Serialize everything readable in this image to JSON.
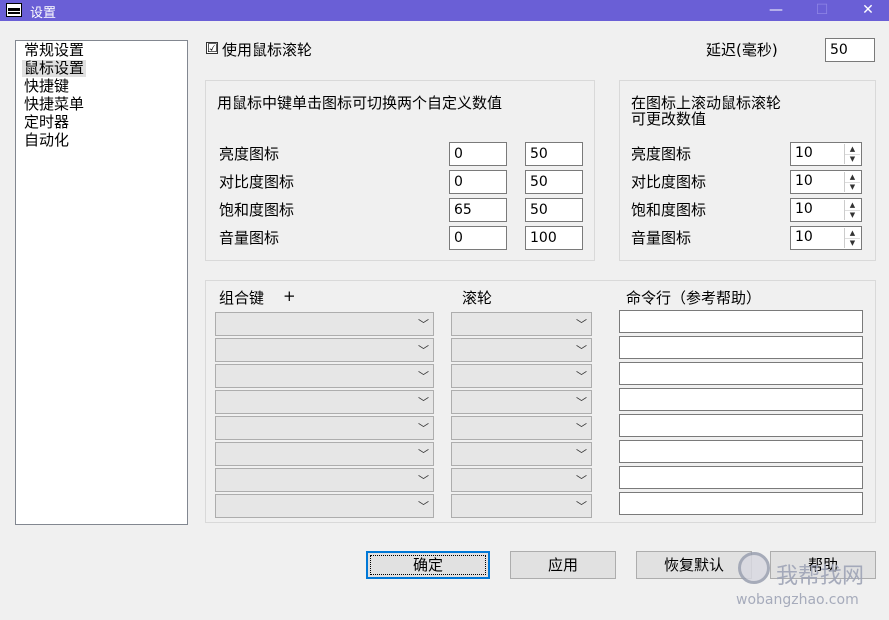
{
  "window": {
    "title": "设置",
    "minimize": "—",
    "maximize": "☐",
    "close": "✕"
  },
  "nav": {
    "items": [
      "常规设置",
      "鼠标设置",
      "快捷键",
      "快捷菜单",
      "定时器",
      "自动化"
    ],
    "selected": "鼠标设置"
  },
  "use_wheel": {
    "label": "使用鼠标滚轮",
    "checked": true,
    "mark": "☑"
  },
  "delay": {
    "label": "延迟(毫秒)",
    "value": "50"
  },
  "middle_click_group": {
    "title": "用鼠标中键单击图标可切换两个自定义数值",
    "rows": [
      {
        "label": "亮度图标",
        "value1": "0",
        "value2": "50"
      },
      {
        "label": "对比度图标",
        "value1": "0",
        "value2": "50"
      },
      {
        "label": "饱和度图标",
        "value1": "65",
        "value2": "50"
      },
      {
        "label": "音量图标",
        "value1": "0",
        "value2": "100"
      }
    ]
  },
  "scroll_group": {
    "title_line1": "在图标上滚动鼠标滚轮",
    "title_line2": "可更改数值",
    "rows": [
      {
        "label": "亮度图标",
        "value": "10"
      },
      {
        "label": "对比度图标",
        "value": "10"
      },
      {
        "label": "饱和度图标",
        "value": "10"
      },
      {
        "label": "音量图标",
        "value": "10"
      }
    ]
  },
  "bindings": {
    "col_hotkey": "组合键",
    "col_plus": "+",
    "col_wheel": "滚轮",
    "col_command": "命令行（参考帮助）",
    "row_count": 8
  },
  "buttons": {
    "ok": "确定",
    "apply": "应用",
    "restore": "恢复默认",
    "help": "帮助"
  },
  "watermark": {
    "text": "我帮找网",
    "url": "wobangzhao.com"
  },
  "colors": {
    "titlebar": "#6a5fd6",
    "focus": "#0078d7"
  }
}
